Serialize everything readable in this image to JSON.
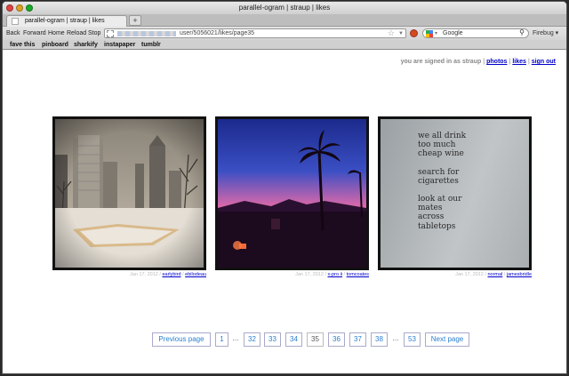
{
  "window": {
    "title": "parallel-ogram | straup | likes"
  },
  "tab": {
    "label": "parallel-ogram | straup | likes",
    "new_tab": "+"
  },
  "nav": {
    "back": "Back",
    "forward": "Forward",
    "home": "Home",
    "reload": "Reload",
    "stop": "Stop",
    "url_visible": "user/5056021/likes/page35",
    "search_engine": "Google",
    "firebug": "Firebug"
  },
  "bookmarks": [
    "fave this",
    "pinboard",
    "sharkify",
    "instapaper",
    "tumblr"
  ],
  "signin": {
    "prefix": "you are signed in as straup",
    "photos": "photos",
    "likes": "likes",
    "signout": "sign out"
  },
  "photos": [
    {
      "date": "Jan 17, 2012",
      "filter": "earlybird",
      "user": "ebilodeau",
      "alt": "snowy city skyline with ice rink"
    },
    {
      "date": "Jan 17, 2012",
      "filter": "x-pro ii",
      "user": "tomcoates",
      "alt": "palm tree silhouette at pink sunset"
    },
    {
      "date": "Jan 17, 2012",
      "filter": "normal",
      "user": "jamesbridle",
      "poem": [
        "we all drink",
        "too much",
        "cheap wine",
        "",
        "search for",
        "cigarettes",
        "",
        "look at our",
        "mates",
        "across",
        "tabletops"
      ]
    }
  ],
  "pager": {
    "prev": "Previous page",
    "next": "Next page",
    "pages": [
      "1",
      "...",
      "32",
      "33",
      "34",
      "35",
      "36",
      "37",
      "38",
      "...",
      "53"
    ],
    "current": "35"
  },
  "colors": {
    "link": "#0000cc",
    "pager_text": "#2a7fd0"
  }
}
